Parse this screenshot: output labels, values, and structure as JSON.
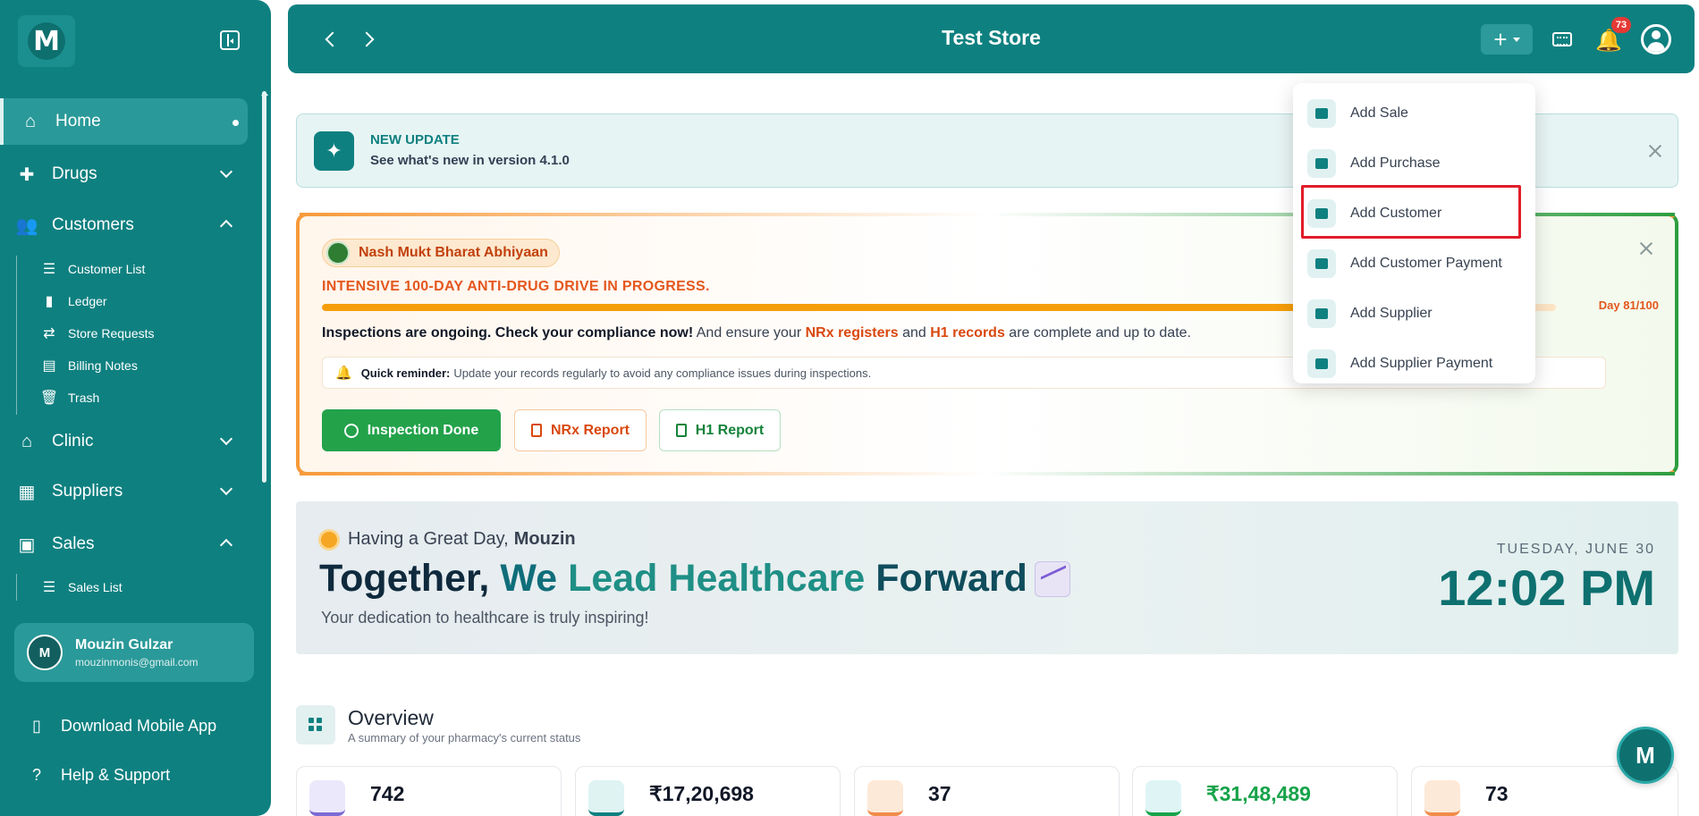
{
  "app": {
    "logo_letter": "M"
  },
  "sidebar": {
    "items": [
      {
        "label": "Home"
      },
      {
        "label": "Drugs"
      },
      {
        "label": "Customers"
      },
      {
        "label": "Clinic"
      },
      {
        "label": "Suppliers"
      },
      {
        "label": "Sales"
      }
    ],
    "customers_sub": [
      {
        "label": "Customer List"
      },
      {
        "label": "Ledger"
      },
      {
        "label": "Store Requests"
      },
      {
        "label": "Billing Notes"
      },
      {
        "label": "Trash"
      }
    ],
    "sales_sub": [
      {
        "label": "Sales List"
      }
    ],
    "user": {
      "initial": "M",
      "name": "Mouzin Gulzar",
      "email": "mouzinmonis@gmail.com"
    },
    "download_label": "Download Mobile App",
    "help_label": "Help & Support"
  },
  "header": {
    "title": "Test Store",
    "notification_count": "73"
  },
  "update_banner": {
    "title": "NEW UPDATE",
    "subtitle": "See what's new in version 4.1.0"
  },
  "campaign": {
    "pill": "Nash Mukt Bharat Abhiyaan",
    "heading": "INTENSIVE 100-DAY ANTI-DRUG DRIVE IN PROGRESS.",
    "progress_fraction": 0.81,
    "day_label": "Day 81/100",
    "text_bold": "Inspections are ongoing. Check your compliance now!",
    "text_1": " And ensure your ",
    "text_nrx": "NRx registers",
    "text_2": " and ",
    "text_h1": "H1 records",
    "text_3": " are complete and up to date.",
    "reminder_bold": "Quick reminder:",
    "reminder_text": "Update your records regularly to avoid any compliance issues during inspections.",
    "btn_done": "Inspection Done",
    "btn_nrx": "NRx Report",
    "btn_h1": "H1 Report"
  },
  "greeting": {
    "line_prefix": "Having a Great Day,",
    "user_name": "Mouzin",
    "title_1": "Together,",
    "title_2": "We",
    "title_3": "Lead Healthcare",
    "title_4": "Forward",
    "subtitle": "Your dedication to healthcare is truly inspiring!",
    "date": "TUESDAY, JUNE 30",
    "time": "12:02 PM"
  },
  "overview": {
    "title": "Overview",
    "subtitle": "A summary of your pharmacy's current status",
    "stats": [
      {
        "value": "742",
        "color": "#7c6ad6",
        "bg": "#ece8fb"
      },
      {
        "value": "₹17,20,698",
        "color": "#0f8080",
        "bg": "#dff3f3"
      },
      {
        "value": "37",
        "color": "#f08c4a",
        "bg": "#fde9d8"
      },
      {
        "value": "₹31,48,489",
        "color": "#16a34a",
        "bg": "#dff5f5"
      },
      {
        "value": "73",
        "color": "#f08c4a",
        "bg": "#fde9d8"
      }
    ]
  },
  "dropdown": {
    "items": [
      {
        "label": "Add Sale"
      },
      {
        "label": "Add Purchase"
      },
      {
        "label": "Add Customer"
      },
      {
        "label": "Add Customer Payment"
      },
      {
        "label": "Add Supplier"
      },
      {
        "label": "Add Supplier Payment"
      }
    ]
  },
  "bot": {
    "letter": "M"
  },
  "colors": {
    "primary": "#0f8080",
    "accent_orange": "#f79a3b",
    "accent_green": "#23a24a",
    "highlight_red": "#e11d2a"
  }
}
